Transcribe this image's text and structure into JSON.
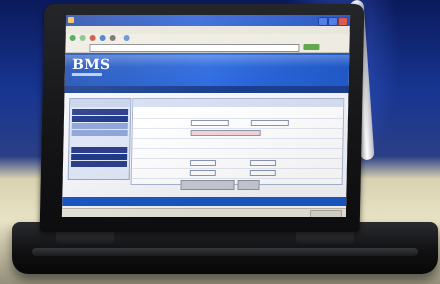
{
  "browser": {
    "title": "",
    "menu": [
      "",
      "",
      "",
      "",
      "",
      ""
    ],
    "address": ""
  },
  "page": {
    "logo": "BMS",
    "nav_title": "",
    "nav_items": [
      "",
      "",
      "",
      "",
      "",
      "",
      ""
    ],
    "form_title": "",
    "rows": [
      {
        "label": "",
        "c1": "",
        "c2": ""
      },
      {
        "label": "",
        "c1": "",
        "c2": ""
      },
      {
        "label": "",
        "c1": "",
        "c2": ""
      },
      {
        "label": "",
        "c1": "",
        "c2": ""
      },
      {
        "label": "",
        "c1": "",
        "c2": ""
      },
      {
        "label": "",
        "c1": "",
        "c2": ""
      },
      {
        "label": "",
        "c1": "",
        "c2": ""
      }
    ],
    "submit_label": "",
    "reset_label": "",
    "footer": ""
  },
  "laptop": {
    "brand": ""
  },
  "colors": {
    "accent": "#2d6be0",
    "nav": "#2d3f8b",
    "highlight": "#c0392b",
    "background_blue": "#173591"
  }
}
